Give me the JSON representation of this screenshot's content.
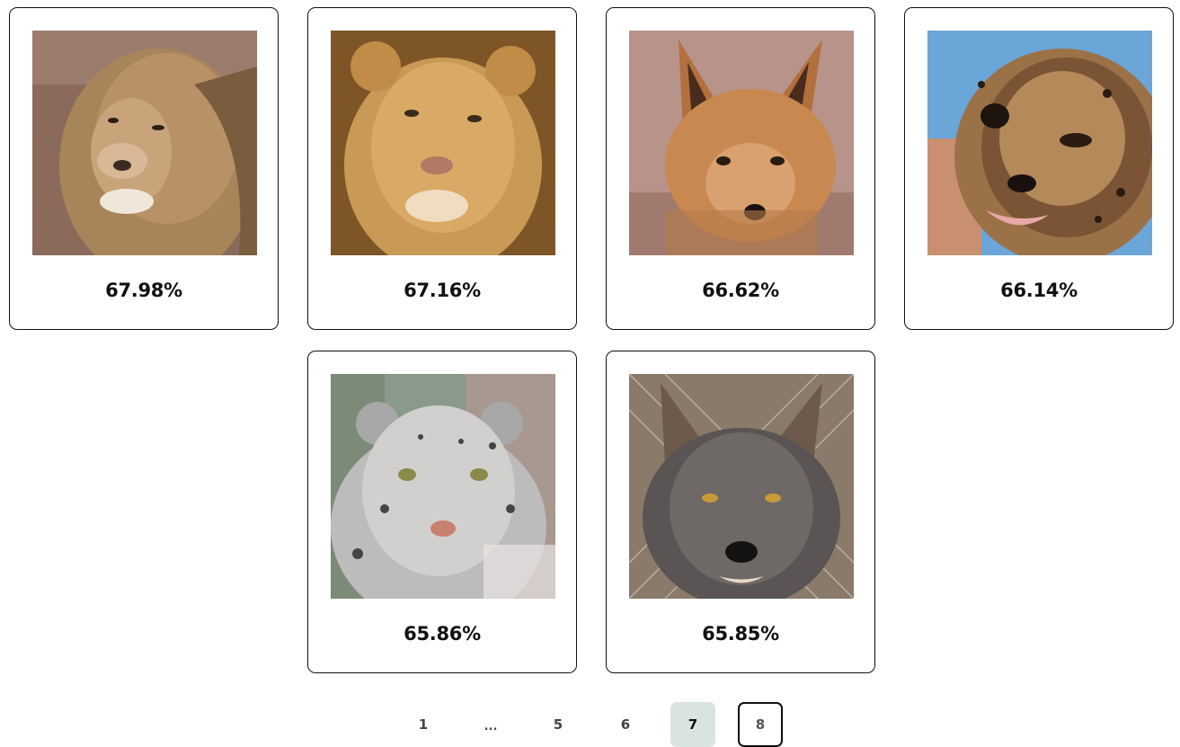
{
  "results": [
    {
      "animal": "lion",
      "score": "67.98%"
    },
    {
      "animal": "lioness",
      "score": "67.16%"
    },
    {
      "animal": "fox",
      "score": "66.62%"
    },
    {
      "animal": "cheetah",
      "score": "66.14%"
    },
    {
      "animal": "snow-leopard",
      "score": "65.86%"
    },
    {
      "animal": "wolf",
      "score": "65.85%"
    }
  ],
  "pagination": {
    "first": "1",
    "ellipsis": "...",
    "p5": "5",
    "p6": "6",
    "current": "7",
    "p8": "8"
  },
  "colors": {
    "active_page_bg": "#d9e4de",
    "card_border": "#111111"
  }
}
